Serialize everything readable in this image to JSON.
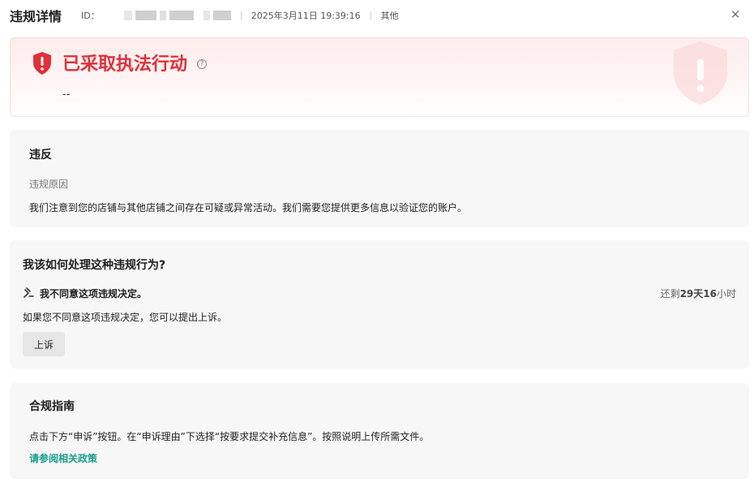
{
  "header": {
    "title": "违规详情",
    "id_label": "ID：",
    "datetime": "2025年3月11日 19:39:16",
    "category": "其他",
    "close_icon": "close-icon"
  },
  "banner": {
    "status": "已采取执法行动",
    "detail": "--",
    "accent_color": "#e0303a",
    "icons": [
      "shield-alert-icon",
      "help-circle-icon"
    ]
  },
  "violation": {
    "title": "违反",
    "reason_label": "违规原因",
    "reason_text": "我们注意到您的店铺与其他店铺之间存在可疑或异常活动。我们需要您提供更多信息以验证您的账户。"
  },
  "handling": {
    "title": "我该如何处理这种违规行为?",
    "option_label": "我不同意这项违规决定。",
    "remain_prefix": "还剩",
    "remain_bold": "29天16",
    "remain_suffix": "小时",
    "option_desc": "如果您不同意这项违规决定，您可以提出上诉。",
    "appeal_button": "上诉",
    "icon": "gavel-icon"
  },
  "guide": {
    "title": "合规指南",
    "text": "点击下方“申诉”按钮。在“申诉理由”下选择“按要求提交补充信息”。按照说明上传所需文件。",
    "link": "请参阅相关政策",
    "link_color": "#1a9e8f"
  }
}
